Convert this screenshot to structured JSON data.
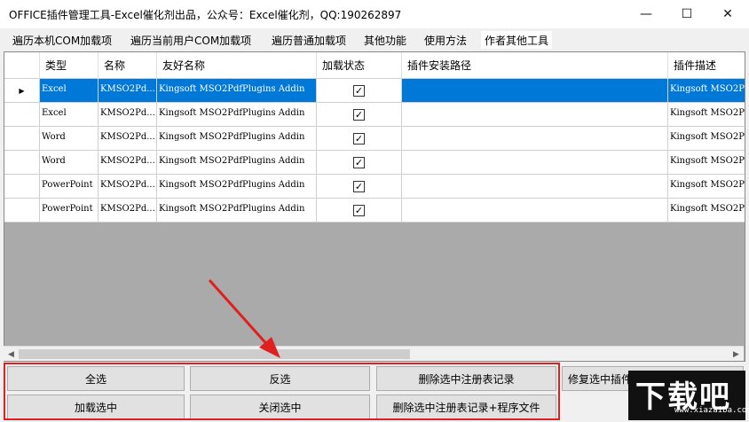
{
  "window": {
    "title": "OFFICE插件管理工具-Excel催化剂出品，公众号：Excel催化剂，QQ:190262897",
    "minimize_glyph": "—",
    "maximize_glyph": "☐",
    "close_glyph": "✕"
  },
  "menu": [
    {
      "label": "遍历本机COM加载项"
    },
    {
      "label": "遍历当前用户COM加载项"
    },
    {
      "label": "遍历普通加载项"
    },
    {
      "label": "其他功能"
    },
    {
      "label": "使用方法"
    },
    {
      "label": "作者其他工具"
    }
  ],
  "grid": {
    "columns": [
      "",
      "类型",
      "名称",
      "友好名称",
      "加载状态",
      "插件安装路径",
      "插件描述"
    ],
    "selected_row_marker": "▶",
    "rows": [
      {
        "type": "Excel",
        "name": "KMSO2Pd...",
        "friendly": "Kingsoft MSO2PdfPlugins Addin",
        "loaded": true,
        "path": "",
        "desc": "Kingsoft MSO2P",
        "selected": true
      },
      {
        "type": "Excel",
        "name": "KMSO2Pd...",
        "friendly": "Kingsoft MSO2PdfPlugins Addin",
        "loaded": true,
        "path": "",
        "desc": "Kingsoft MSO2P",
        "selected": false
      },
      {
        "type": "Word",
        "name": "KMSO2Pd...",
        "friendly": "Kingsoft MSO2PdfPlugins Addin",
        "loaded": true,
        "path": "",
        "desc": "Kingsoft MSO2P",
        "selected": false
      },
      {
        "type": "Word",
        "name": "KMSO2Pd...",
        "friendly": "Kingsoft MSO2PdfPlugins Addin",
        "loaded": true,
        "path": "",
        "desc": "Kingsoft MSO2P",
        "selected": false
      },
      {
        "type": "PowerPoint",
        "name": "KMSO2Pd...",
        "friendly": "Kingsoft MSO2PdfPlugins Addin",
        "loaded": true,
        "path": "",
        "desc": "Kingsoft MSO2P",
        "selected": false
      },
      {
        "type": "PowerPoint",
        "name": "KMSO2Pd...",
        "friendly": "Kingsoft MSO2PdfPlugins Addin",
        "loaded": true,
        "path": "",
        "desc": "Kingsoft MSO2P",
        "selected": false
      }
    ],
    "check_glyph": "✓",
    "scroll_left_glyph": "◀",
    "scroll_right_glyph": "▶"
  },
  "buttons": {
    "select_all": "全选",
    "invert": "反选",
    "delete_registry": "删除选中注册表记录",
    "repair": "修复选中插件",
    "load_selected": "加载选中",
    "close_selected": "关闭选中",
    "delete_registry_files": "删除选中注册表记录+程序文件"
  },
  "watermark": {
    "logo_text": "下载吧",
    "url": "www.xiazaiba.com"
  },
  "colors": {
    "selection": "#0078d7",
    "highlight_frame": "#e02020",
    "grid_background": "#aaaaaa"
  }
}
